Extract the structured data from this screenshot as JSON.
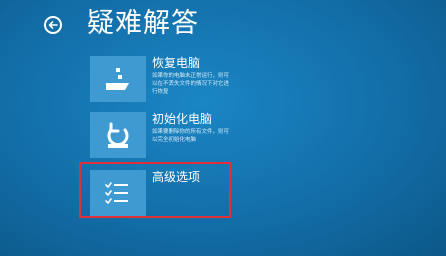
{
  "header": {
    "title": "疑难解答"
  },
  "options": [
    {
      "title": "恢复电脑",
      "description": "如果你的电脑未正常运行，则可以在不丢失文件的情况下对它进行恢复",
      "icon": "refresh-pc-icon"
    },
    {
      "title": "初始化电脑",
      "description": "如果要删除你的所有文件，则可以完全初始化电脑",
      "icon": "reset-pc-icon"
    },
    {
      "title": "高级选项",
      "description": "",
      "icon": "checklist-icon"
    }
  ],
  "colors": {
    "background": "#136ea8",
    "tile": "#3f9ad2",
    "highlight": "#e0303a",
    "text": "#ffffff"
  }
}
